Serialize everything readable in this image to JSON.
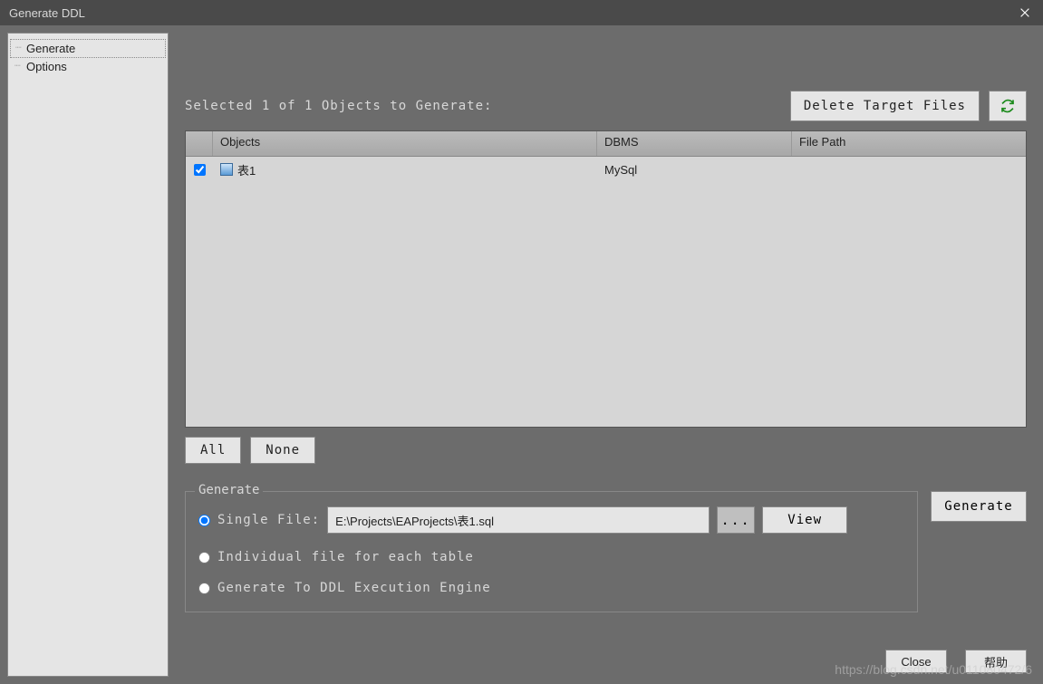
{
  "window": {
    "title": "Generate DDL"
  },
  "sidebar": {
    "items": [
      {
        "label": "Generate",
        "selected": true
      },
      {
        "label": "Options",
        "selected": false
      }
    ]
  },
  "status": {
    "text": "Selected  1 of 1  Objects to Generate:"
  },
  "toolbar": {
    "delete_label": "Delete Target Files"
  },
  "table": {
    "headers": {
      "objects": "Objects",
      "dbms": "DBMS",
      "path": "File Path"
    },
    "rows": [
      {
        "checked": true,
        "name": "表1",
        "dbms": "MySql",
        "path": ""
      }
    ]
  },
  "selection": {
    "all": "All",
    "none": "None"
  },
  "generate": {
    "legend": "Generate",
    "single_label": "Single File:",
    "file_value": "E:\\Projects\\EAProjects\\表1.sql",
    "browse": "...",
    "view": "View",
    "individual_label": "Individual file for each table",
    "engine_label": "Generate To DDL Execution Engine",
    "button": "Generate"
  },
  "footer": {
    "close": "Close",
    "help": "帮助"
  },
  "watermark": "https://blog.csdn.net/u011080472/6"
}
